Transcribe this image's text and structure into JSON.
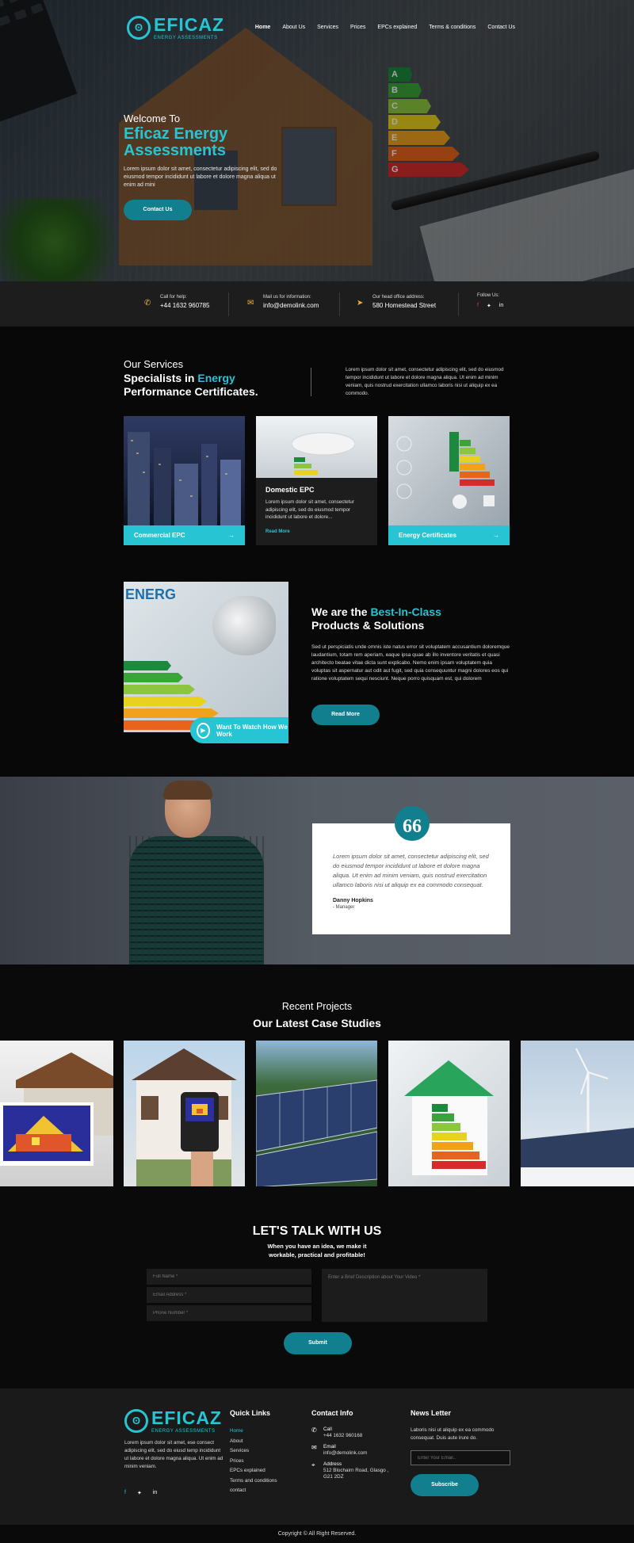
{
  "brand": {
    "name": "EFICAZ",
    "tagline": "ENERGY ASSESSMENTS",
    "accent": "#27c4d4",
    "dark_accent": "#117f8e"
  },
  "nav": {
    "items": [
      "Home",
      "About Us",
      "Services",
      "Prices",
      "EPCs explained",
      "Terms & conditions",
      "Contact Us"
    ],
    "active": "Home"
  },
  "hero": {
    "welcome": "Welcome To",
    "title": "Eficaz Energy Assessments",
    "text": "Lorem ipsum dolor sit amet, consectetur adipiscing elit, sed do eiusmod tempor incididunt ut labore et dolore magna aliqua ut enim ad mini",
    "button": "Contact Us"
  },
  "contact_bar": {
    "help_label": "Call for help:",
    "help_value": "+44 1632 960785",
    "mail_label": "Mail us for information:",
    "mail_value": "info@demolink.com",
    "office_label": "Our head office address:",
    "office_value": "580 Homestead Street",
    "follow_label": "Follow Us:"
  },
  "services": {
    "subtitle": "Our Services",
    "title_a": "Specialists in ",
    "title_accent": "Energy",
    "title_b": "Performance Certificates.",
    "description": "Lorem ipsum dolor sit amet, consectetur adipiscing elit, sed do eiusmod tempor incididunt ut labore et dolore magna aliqua. Ut enim ad minim veniam, quis nostrud exercitation ullamco laboris nisi ut aliquip ex ea commodo.",
    "cards": [
      {
        "title": "Commercial EPC"
      },
      {
        "title": "Domestic EPC",
        "text": "Lorem ipsum dolor sit amet, consectetur adipiscing elit, sed do eiusmod tempor incididunt ut labore et dolore...",
        "more": "Read More"
      },
      {
        "title": "Energy Certificates"
      }
    ]
  },
  "best": {
    "title_a": "We are the ",
    "title_accent": "Best-In-Class",
    "title_b": "Products & Solutions",
    "text": "Sed ut perspiciatis unde omnis iste natus error sit voluptatem accusantium doloremque laudantium, totam rem aperiam, eaque ipsa quae ab illo inventore veritatis et quasi architecto beatae vitae dicta sunt explicabo. Nemo enim ipsam voluptatem quia voluptas sit aspernatur aut odit aut fugit, sed quia consequuntur magni dolores eos qui ratione voluptatem sequi nesciunt. Neque porro quisquam est, qui dolorem",
    "button": "Read More",
    "watch": "Want To Watch How We Work",
    "image_label": "ENERG"
  },
  "testimonial": {
    "quote_mark": "66",
    "text": "Lorem ipsum dolor sit amet, consectetur adipiscing elit, sed do eiusmod tempor incididunt ut labore et dolore magna aliqua. Ut enim ad minim veniam, quis nostrud exercitation ullamco laboris nisi ut aliquip ex ea commodo consequat.",
    "name": "Danny Hopkins",
    "role": "- Manager"
  },
  "projects": {
    "subtitle": "Recent Projects",
    "title": "Our Latest Case Studies"
  },
  "talk": {
    "title": "LET'S TALK WITH US",
    "subtitle": "When you have an idea, we make it workable, practical and profitable!",
    "full_name": "Full Name *",
    "email": "Email Address *",
    "phone": "Phone Number *",
    "message": "Enter a Brief Description about Your Video *",
    "submit": "Submit"
  },
  "footer": {
    "about": "Lorem ipsum dolor sit amet, ese consect adipiscing elit, sed do eiusd temp incididunt ut labore et dolore magna aliqua. Ut enim ad minim veniam.",
    "quick_title": "Quick Links",
    "links": [
      "Home",
      "About",
      "Services",
      "Prices",
      "EPCs explained",
      "Terms and conditions",
      "contact"
    ],
    "contact_title": "Contact Info",
    "call_label": "Call",
    "call_value": "+44 1632 960168",
    "email_label": "Email",
    "email_value": "info@demolink.com",
    "address_label": "Address",
    "address_value": "512 Blochairn Road, Glasgo , G21 2DZ",
    "news_title": "News Letter",
    "news_text": "Laboris nisi ut aliquip ex ea commodo consequat. Duis aute irure do.",
    "email_placeholder": "Enter Your Email..",
    "subscribe": "Subscribe",
    "copyright": "Copyright © All Right Reserved."
  }
}
